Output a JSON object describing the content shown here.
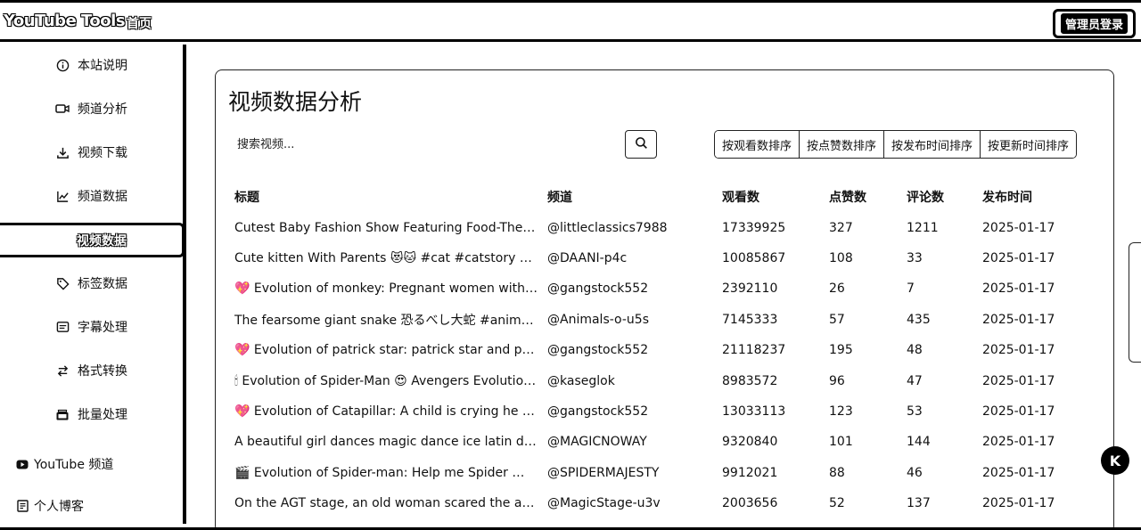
{
  "header": {
    "logo": "YouTube Tools",
    "home": "首页",
    "admin_login": "管理员登录"
  },
  "sidebar": {
    "items": [
      {
        "label": "本站说明",
        "icon": "info-icon"
      },
      {
        "label": "频道分析",
        "icon": "video-icon"
      },
      {
        "label": "视频下载",
        "icon": "download-icon"
      },
      {
        "label": "频道数据",
        "icon": "chart-icon"
      },
      {
        "label": "视频数据",
        "icon": "none",
        "active": true
      },
      {
        "label": "标签数据",
        "icon": "tag-icon"
      },
      {
        "label": "字幕处理",
        "icon": "subtitle-icon"
      },
      {
        "label": "格式转换",
        "icon": "convert-icon"
      },
      {
        "label": "批量处理",
        "icon": "batch-icon"
      }
    ],
    "external": [
      {
        "label": "YouTube 频道",
        "icon": "youtube-icon"
      },
      {
        "label": "个人博客",
        "icon": "blog-icon"
      }
    ]
  },
  "main": {
    "title": "视频数据分析",
    "search_placeholder": "搜索视频...",
    "sort_buttons": [
      "按观看数排序",
      "按点赞数排序",
      "按发布时间排序",
      "按更新时间排序"
    ],
    "columns": [
      "标题",
      "频道",
      "观看数",
      "点赞数",
      "评论数",
      "发布时间"
    ],
    "rows": [
      {
        "title": "Cutest Baby Fashion Show Featuring Food-Theme...",
        "channel": "@littleclassics7988",
        "views": "17339925",
        "likes": "327",
        "comments": "1211",
        "date": "2025-01-17"
      },
      {
        "title": "Cute kitten With Parents 😻🐱 #cat #catstory #pe...",
        "channel": "@DAANI-p4c",
        "views": "10085867",
        "likes": "108",
        "comments": "33",
        "date": "2025-01-17"
      },
      {
        "title": "💖 Evolution of monkey: Pregnant women with Dr...",
        "channel": "@gangstock552",
        "views": "2392110",
        "likes": "26",
        "comments": "7",
        "date": "2025-01-17"
      },
      {
        "title": "The fearsome giant snake 恐るべし大蛇 #animals #...",
        "channel": "@Animals-o-u5s",
        "views": "7145333",
        "likes": "57",
        "comments": "435",
        "date": "2025-01-17"
      },
      {
        "title": "💖 Evolution of patrick star: patrick star and pregn...",
        "channel": "@gangstock552",
        "views": "21118237",
        "likes": "195",
        "comments": "48",
        "date": "2025-01-17"
      },
      {
        "title": "🕯 Evolution of Spider-Man 😍 Avengers Evolution...",
        "channel": "@kaseglok",
        "views": "8983572",
        "likes": "96",
        "comments": "47",
        "date": "2025-01-17"
      },
      {
        "title": "💖 Evolution of Catapillar: A child is crying he see...",
        "channel": "@gangstock552",
        "views": "13033113",
        "likes": "123",
        "comments": "53",
        "date": "2025-01-17"
      },
      {
        "title": "A beautiful girl dances magic dance ice latin danci...",
        "channel": "@MAGICNOWAY",
        "views": "9320840",
        "likes": "101",
        "comments": "144",
        "date": "2025-01-17"
      },
      {
        "title": "🎬 Evolution of Spider-man: Help me Spider 🆘 #...",
        "channel": "@SPIDERMAJESTY",
        "views": "9912021",
        "likes": "88",
        "comments": "46",
        "date": "2025-01-17"
      },
      {
        "title": "On the AGT stage, an old woman scared the audie...",
        "channel": "@MagicStage-u3v",
        "views": "2003656",
        "likes": "52",
        "comments": "137",
        "date": "2025-01-17"
      }
    ]
  },
  "floating": {
    "badge": "K"
  }
}
